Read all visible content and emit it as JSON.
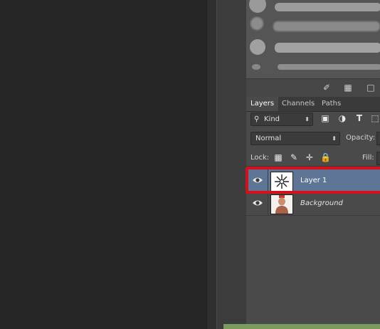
{
  "layers_panel": {
    "tabs": [
      {
        "label": "Layers",
        "active": true
      },
      {
        "label": "Channels",
        "active": false
      },
      {
        "label": "Paths",
        "active": false
      }
    ],
    "filter": {
      "kind_label": "Kind"
    },
    "blend_mode": {
      "value": "Normal"
    },
    "opacity_label": "Opacity:",
    "lock_label": "Lock:",
    "fill_label": "Fill:",
    "layers": [
      {
        "name": "Layer 1",
        "visible": true,
        "selected": true
      },
      {
        "name": "Background",
        "visible": true,
        "selected": false
      }
    ]
  },
  "colors": {
    "selected_layer": "#5e7595",
    "highlight_outline": "#d4101a",
    "panel_bg": "#4a4a4a"
  }
}
